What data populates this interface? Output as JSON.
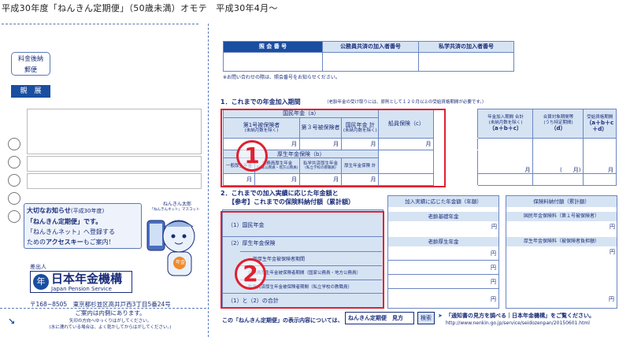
{
  "header": {
    "title": "平成30年度「ねんきん定期便」（50歳未満）オモテ　平成30年4月〜"
  },
  "left": {
    "postage": {
      "line1": "料金後納",
      "line2": "郵便"
    },
    "shinten": "親　展",
    "notice": {
      "line1a": "大切なお知らせ",
      "line1b": "(平成30年度)",
      "line2": "「ねんきん定期便」です。",
      "line3": "「ねんきんネット」へ登録する",
      "line4a": "ための",
      "line4b": "アクセスキー",
      "line4c": "もご案内！"
    },
    "mascot": {
      "name": "ねんきん太郎",
      "sub": "「ねんきんネット」マスコット",
      "badge": "年金"
    },
    "sender_label": "差出人",
    "org": {
      "name": "日本年金機構",
      "en": "Japan Pension Service",
      "logo": "年"
    },
    "address": "〒168−8505　東京都杉並区高井戸西3丁目5番24号",
    "footer": {
      "line1": "ご案内は内側にあります。",
      "line2": "矢印の方向へゆっくりはがしてください。",
      "line3": "(水に濡れている場合は、よく乾かしてからはがしてください。)"
    }
  },
  "right": {
    "id_table": {
      "headers": [
        "照 会 番 号",
        "公務員共済の加入者番号",
        "私学共済の加入者番号"
      ],
      "note": "※お問い合わせの際は、照会番号をお知らせください。"
    },
    "section1": {
      "title": "1．これまでの年金加入期間",
      "note": "（老齢年金の受け取りには、原則として１２０月以上の受給資格期間が必要です。）",
      "national": "国民年金（a）",
      "cols": [
        {
          "l1": "第1号被保険者",
          "l2": "(未納月数を除く)"
        },
        {
          "l1": "第３号被保険者",
          "l2": ""
        },
        {
          "l1": "国民年金 計",
          "l2": "(未納月数を除く)"
        }
      ],
      "seamen": "船員保険（c）",
      "welfare": "厚生年金保険（b）",
      "wcols": [
        {
          "l1": "一般厚生年金",
          "l2": ""
        },
        {
          "l1": "公務員厚生年金",
          "l2": "(国家公務員・地方公務員)"
        },
        {
          "l1": "私学共済厚生年金",
          "l2": "(私立学校の教職員)"
        },
        {
          "l1": "厚生年金保険 計",
          "l2": ""
        }
      ],
      "month": "月",
      "total": {
        "l1": "年金加入期間 合計",
        "l2": "(未納月数を除く)",
        "l3": "（a＋b＋c）"
      },
      "target": {
        "l1": "合算対象期間等",
        "l2": "(うち特定期間)",
        "l3": "（d）"
      },
      "target_paren": "(　　月)",
      "qual": {
        "l1": "受給資格期間",
        "l3": "（a＋b＋c＋d）"
      }
    },
    "section2": {
      "title": "2．これまでの加入実績に応じた年金額と",
      "title2": "【参考】これまでの保険料納付額（累計額）",
      "rows": [
        "（1）国民年金",
        "（2）厚生年金保険",
        "一般厚生年金被保険者期間",
        "公務員厚生年金被保険者期間（国家公務員・地方公務員）",
        "私学共済厚生年金被保険者期間（私立学校の教職員）",
        "（1）と（2）の合計"
      ],
      "amount_header": "加入実績に応じた年金額（年額）",
      "paid_header": "保険料納付額（累計額）",
      "basic": "老齢基礎年金",
      "welfare_pen": "老齢厚生年金",
      "national_paid": "国民年金保険料（第１号被保険者）",
      "welfare_paid": "厚生年金保険料（被保険者負担額）",
      "yen": "円"
    },
    "bottom": {
      "text1": "この「ねんきん定期便」の表示内容については、",
      "search_text": "ねんきん定期便　見方",
      "search_btn": "検索",
      "text2": "「通知書の見方を調べる｜日本年金機構」をご覧ください。",
      "url": "http://www.nenkin.go.jp/service/seidozenpan/20150601.html"
    }
  },
  "markers": {
    "one": "1",
    "two": "2"
  }
}
